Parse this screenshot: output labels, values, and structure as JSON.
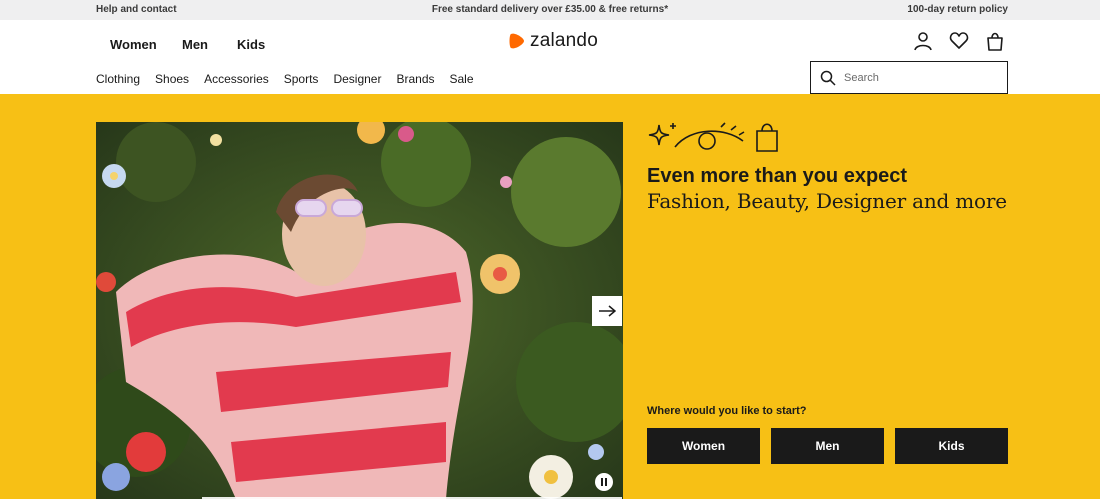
{
  "topbar": {
    "help": "Help and contact",
    "delivery": "Free standard delivery over £35.00 & free returns*",
    "returns": "100-day return policy"
  },
  "header": {
    "genders": [
      "Women",
      "Men",
      "Kids"
    ],
    "logo_text": "zalando",
    "categories": [
      "Clothing",
      "Shoes",
      "Accessories",
      "Sports",
      "Designer",
      "Brands",
      "Sale"
    ],
    "search_placeholder": "Search",
    "icons": [
      "user-icon",
      "heart-icon",
      "bag-icon"
    ]
  },
  "hero": {
    "headline": "Even more than you expect",
    "subline": "Fashion, Beauty, Designer and more",
    "question": "Where would you like to start?",
    "buttons": [
      "Women",
      "Men",
      "Kids"
    ],
    "background_color": "#f7c015",
    "accent_color": "#ff6900"
  }
}
